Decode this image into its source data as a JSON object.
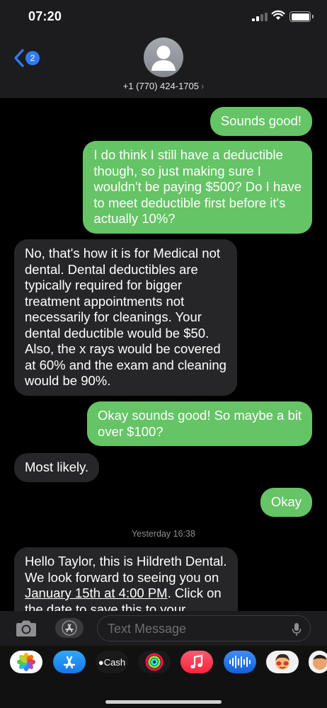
{
  "status_bar": {
    "time": "07:20"
  },
  "header": {
    "back_badge": "2",
    "contact": "+1 (770) 424-1705",
    "contact_chevron": "›"
  },
  "messages": [
    {
      "direction": "outgoing",
      "text": "Sounds good!"
    },
    {
      "direction": "outgoing",
      "lines": [
        "I do think I still have a deductible",
        "though, so just making sure I",
        "wouldn't be paying $500? Do I have",
        "to meet deductible first before it's",
        "actually 10%?"
      ]
    },
    {
      "direction": "incoming",
      "lines": [
        "No, that's how it is for Medical not",
        "dental. Dental deductibles are",
        "typically required for bigger",
        "treatment appointments not",
        "necessarily for cleanings. Your",
        "dental deductible would be $50.",
        "Also, the x rays would be covered",
        "at 60% and the exam and cleaning",
        "would be 90%."
      ]
    },
    {
      "direction": "outgoing",
      "lines": [
        "Okay sounds good! So maybe a bit",
        "over $100?"
      ]
    },
    {
      "direction": "incoming",
      "text": "Most likely."
    },
    {
      "direction": "outgoing",
      "text": "Okay"
    }
  ],
  "timestamp": "Yesterday 16:38",
  "last_message": {
    "direction": "incoming",
    "line1": "Hello Taylor, this is Hildreth Dental.",
    "line2": "We look forward to seeing you on",
    "link": "January 15th at 4:00 PM",
    "line3_after_link": ". Click on",
    "line4": "the date to save this to your"
  },
  "compose": {
    "placeholder": "Text Message"
  },
  "app_strip": {
    "apps": [
      {
        "name": "photos-app-icon"
      },
      {
        "name": "app-store-icon"
      },
      {
        "name": "apple-cash-icon",
        "label": "Cash"
      },
      {
        "name": "activity-app-icon"
      },
      {
        "name": "music-app-icon"
      },
      {
        "name": "audio-message-icon"
      },
      {
        "name": "memoji-icon"
      },
      {
        "name": "memoji-stickers-icon"
      }
    ]
  },
  "colors": {
    "outgoing_bubble": "#65c466",
    "incoming_bubble": "#262628",
    "badge": "#2f7bf5",
    "background": "#000000"
  }
}
